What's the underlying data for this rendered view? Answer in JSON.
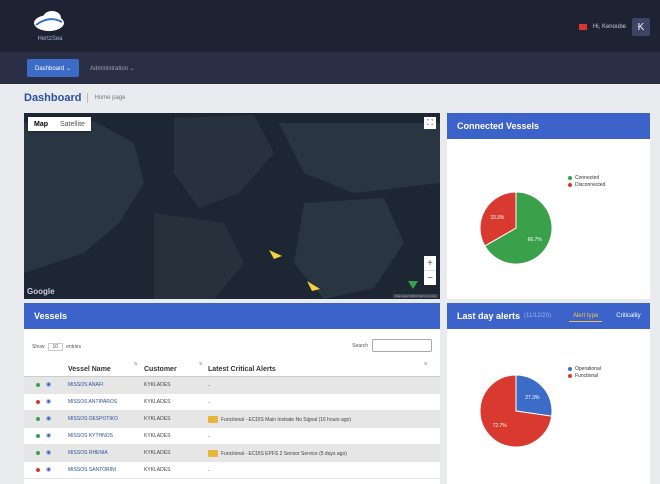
{
  "app": {
    "logo_text": "HertzSea"
  },
  "user": {
    "greeting": "Hi, Kenoube",
    "initial": "K"
  },
  "nav": {
    "items": [
      {
        "label": "Dashboard ⌄"
      },
      {
        "label": "Administration ⌄"
      }
    ]
  },
  "breadcrumb": {
    "title": "Dashboard",
    "subtitle": "Home page"
  },
  "map": {
    "tabs": [
      "Map",
      "Satellite"
    ],
    "fullscreen_icon": "⛶",
    "zoom_in": "+",
    "zoom_out": "−",
    "google_label": "Google",
    "attribution": "Map data ©2020  Terms of Use"
  },
  "connected_vessels": {
    "title": "Connected Vessels",
    "legend": [
      {
        "label": "Connected",
        "color": "#3aa14a"
      },
      {
        "label": "Disconnected",
        "color": "#d83a2f"
      }
    ],
    "chart_data": {
      "type": "pie",
      "categories": [
        "Connected",
        "Disconnected"
      ],
      "values": [
        66.7,
        33.3
      ],
      "labels": [
        "66.7%",
        "33.3%"
      ],
      "colors": [
        "#3aa14a",
        "#d83a2f"
      ]
    }
  },
  "last_day_alerts": {
    "title": "Last day alerts",
    "count": "(11/12/20)",
    "tabs": [
      "Alert type",
      "Criticality"
    ],
    "legend": [
      {
        "label": "Operational",
        "color": "#3b6cc7"
      },
      {
        "label": "Functional",
        "color": "#d83a2f"
      }
    ],
    "chart_data": {
      "type": "pie",
      "categories": [
        "Operational",
        "Functional"
      ],
      "values": [
        27.3,
        72.7
      ],
      "labels": [
        "27.3%",
        "72.7%"
      ],
      "colors": [
        "#3b6cc7",
        "#d83a2f"
      ]
    }
  },
  "vessels": {
    "title": "Vessels",
    "show_label": "Show",
    "show_value": "10",
    "entries_label": "entries",
    "search_label": "Search",
    "columns": [
      "Vessel Name",
      "Customer",
      "Latest Critical Alerts"
    ],
    "rows": [
      {
        "status": "#3aa14a",
        "name": "MISSOS ANAFI",
        "customer": "KYKLADES",
        "alert": "-",
        "has_alert": false
      },
      {
        "status": "#d83a2f",
        "name": "MISSOS ANTIPAROS",
        "customer": "KYKLADES",
        "alert": "-",
        "has_alert": false
      },
      {
        "status": "#3aa14a",
        "name": "MISSOS DESPOTIKO",
        "customer": "KYKLADES",
        "alert": "Functional - ECDIS Main Instrate No Signal (16 hours ago)",
        "has_alert": true
      },
      {
        "status": "#3aa14a",
        "name": "MISSOS KYTHNOS",
        "customer": "KYKLADES",
        "alert": "-",
        "has_alert": false
      },
      {
        "status": "#3aa14a",
        "name": "MISSOS RHENIA",
        "customer": "KYKLADES",
        "alert": "Functional - ECDIS EPFS 2 Sensor Service (5 days ago)",
        "has_alert": true
      },
      {
        "status": "#d83a2f",
        "name": "MISSOS SANTORINI",
        "customer": "KYKLADES",
        "alert": "-",
        "has_alert": false
      }
    ]
  }
}
